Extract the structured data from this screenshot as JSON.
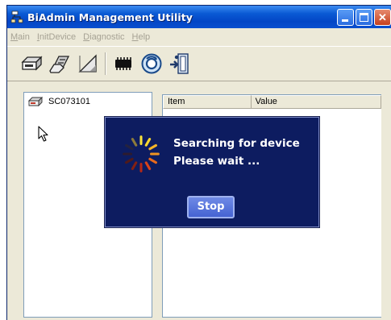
{
  "window": {
    "title": "BiAdmin Management Utility",
    "icons": {
      "app": "tree-network-icon",
      "minimize": "minimize-icon",
      "maximize": "maximize-icon",
      "close": "close-icon"
    }
  },
  "menu": {
    "items": [
      {
        "label": "Main"
      },
      {
        "label": "InitDevice"
      },
      {
        "label": "Diagnostic"
      },
      {
        "label": "Help"
      }
    ],
    "state": "disabled"
  },
  "toolbar": {
    "buttons": [
      {
        "icon": "device-drive-icon"
      },
      {
        "icon": "hand-device-icon"
      },
      {
        "icon": "ruler-triangle-icon"
      },
      {
        "icon": "chip-icon"
      },
      {
        "icon": "refresh-circle-icon"
      },
      {
        "icon": "exit-door-icon"
      }
    ]
  },
  "tree": {
    "device_label": "SC073101",
    "device_icon": "device-drive-icon"
  },
  "grid": {
    "columns": [
      "Item",
      "Value"
    ]
  },
  "dialog": {
    "line1": "Searching for device",
    "line2": "Please wait ...",
    "stop_label": "Stop",
    "spinner_icon": "loading-spinner-icon"
  },
  "colors": {
    "titlebar": "#0a5ad4",
    "dialog_bg": "#0d1c60",
    "stop_button": "#5673db",
    "window_bg": "#ece9d8"
  }
}
